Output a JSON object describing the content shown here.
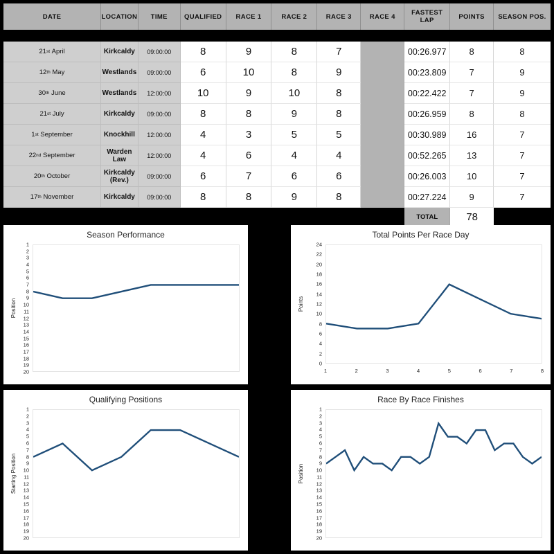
{
  "theme": {
    "background": "#000000",
    "header_bg": "#b3b3b3",
    "label_cell_bg": "#cfcfcf",
    "blank_cell_bg": "#b3b3b3",
    "line_color": "#1f4e79",
    "panel_bg": "#ffffff"
  },
  "table": {
    "columns": [
      "DATE",
      "LOCATION",
      "TIME",
      "QUALIFIED",
      "RACE 1",
      "RACE 2",
      "RACE 3",
      "RACE 4",
      "FASTEST LAP",
      "POINTS",
      "SEASON POS."
    ],
    "rows": [
      {
        "day": "21",
        "ord": "st",
        "month": "April",
        "location": "Kirkcaldy",
        "time": "09:00:00",
        "qualified": "8",
        "race1": "9",
        "race2": "8",
        "race3": "7",
        "race4": "",
        "fastest_lap": "00:26.977",
        "points": "8",
        "season_pos": "8"
      },
      {
        "day": "12",
        "ord": "th",
        "month": "May",
        "location": "Westlands",
        "time": "09:00:00",
        "qualified": "6",
        "race1": "10",
        "race2": "8",
        "race3": "9",
        "race4": "",
        "fastest_lap": "00:23.809",
        "points": "7",
        "season_pos": "9"
      },
      {
        "day": "30",
        "ord": "th",
        "month": "June",
        "location": "Westlands",
        "time": "12:00:00",
        "qualified": "10",
        "race1": "9",
        "race2": "10",
        "race3": "8",
        "race4": "",
        "fastest_lap": "00:22.422",
        "points": "7",
        "season_pos": "9"
      },
      {
        "day": "21",
        "ord": "st",
        "month": "July",
        "location": "Kirkcaldy",
        "time": "09:00:00",
        "qualified": "8",
        "race1": "8",
        "race2": "9",
        "race3": "8",
        "race4": "",
        "fastest_lap": "00:26.959",
        "points": "8",
        "season_pos": "8"
      },
      {
        "day": "1",
        "ord": "st",
        "month": "September",
        "location": "Knockhill",
        "time": "12:00:00",
        "qualified": "4",
        "race1": "3",
        "race2": "5",
        "race3": "5",
        "race4": "",
        "fastest_lap": "00:30.989",
        "points": "16",
        "season_pos": "7"
      },
      {
        "day": "22",
        "ord": "nd",
        "month": "September",
        "location": "Warden Law",
        "time": "12:00:00",
        "qualified": "4",
        "race1": "6",
        "race2": "4",
        "race3": "4",
        "race4": "",
        "fastest_lap": "00:52.265",
        "points": "13",
        "season_pos": "7"
      },
      {
        "day": "20",
        "ord": "th",
        "month": "October",
        "location": "Kirkcaldy (Rev.)",
        "time": "09:00:00",
        "qualified": "6",
        "race1": "7",
        "race2": "6",
        "race3": "6",
        "race4": "",
        "fastest_lap": "00:26.003",
        "points": "10",
        "season_pos": "7"
      },
      {
        "day": "17",
        "ord": "th",
        "month": "November",
        "location": "Kirkcaldy",
        "time": "09:00:00",
        "qualified": "8",
        "race1": "8",
        "race2": "9",
        "race3": "8",
        "race4": "",
        "fastest_lap": "00:27.224",
        "points": "9",
        "season_pos": "7"
      }
    ],
    "total_label": "TOTAL",
    "total_value": "78"
  },
  "chart_data": [
    {
      "id": "season-performance",
      "type": "line",
      "title": "Season Performance",
      "xlabel": "",
      "ylabel": "Position",
      "x": [
        1,
        2,
        3,
        4,
        5,
        6,
        7,
        8
      ],
      "values": [
        8,
        9,
        9,
        8,
        7,
        7,
        7,
        7
      ],
      "yticks": [
        1,
        2,
        3,
        4,
        5,
        6,
        7,
        8,
        9,
        10,
        11,
        12,
        13,
        14,
        15,
        16,
        17,
        18,
        19,
        20
      ],
      "ylim": [
        1,
        20
      ],
      "y_inverted": true,
      "xticks": [],
      "grid": false,
      "legend": "none"
    },
    {
      "id": "total-points-per-race-day",
      "type": "line",
      "title": "Total Points Per Race Day",
      "xlabel": "",
      "ylabel": "Points",
      "x": [
        1,
        2,
        3,
        4,
        5,
        6,
        7,
        8
      ],
      "values": [
        8,
        7,
        7,
        8,
        16,
        13,
        10,
        9
      ],
      "yticks": [
        0,
        2,
        4,
        6,
        8,
        10,
        12,
        14,
        16,
        18,
        20,
        22,
        24
      ],
      "ylim": [
        0,
        24
      ],
      "y_inverted": false,
      "xticks": [
        1,
        2,
        3,
        4,
        5,
        6,
        7,
        8
      ],
      "grid": false,
      "legend": "none"
    },
    {
      "id": "qualifying-positions",
      "type": "line",
      "title": "Qualifying Positions",
      "xlabel": "",
      "ylabel": "Starting Position",
      "x": [
        1,
        2,
        3,
        4,
        5,
        6,
        7,
        8
      ],
      "values": [
        8,
        6,
        10,
        8,
        4,
        4,
        6,
        8
      ],
      "yticks": [
        1,
        2,
        3,
        4,
        5,
        6,
        7,
        8,
        9,
        10,
        11,
        12,
        13,
        14,
        15,
        16,
        17,
        18,
        19,
        20
      ],
      "ylim": [
        1,
        20
      ],
      "y_inverted": true,
      "xticks": [],
      "grid": false,
      "legend": "none"
    },
    {
      "id": "race-by-race-finishes",
      "type": "line",
      "title": "Race By Race Finishes",
      "xlabel": "",
      "ylabel": "Position",
      "x": [
        1,
        2,
        3,
        4,
        5,
        6,
        7,
        8,
        9,
        10,
        11,
        12,
        13,
        14,
        15,
        16,
        17,
        18,
        19,
        20,
        21,
        22,
        23,
        24
      ],
      "values": [
        9,
        8,
        7,
        10,
        8,
        9,
        9,
        10,
        8,
        8,
        9,
        8,
        3,
        5,
        5,
        6,
        4,
        4,
        7,
        6,
        6,
        8,
        9,
        8
      ],
      "yticks": [
        1,
        2,
        3,
        4,
        5,
        6,
        7,
        8,
        9,
        10,
        11,
        12,
        13,
        14,
        15,
        16,
        17,
        18,
        19,
        20
      ],
      "ylim": [
        1,
        20
      ],
      "y_inverted": true,
      "xticks": [],
      "grid": false,
      "legend": "none"
    }
  ]
}
